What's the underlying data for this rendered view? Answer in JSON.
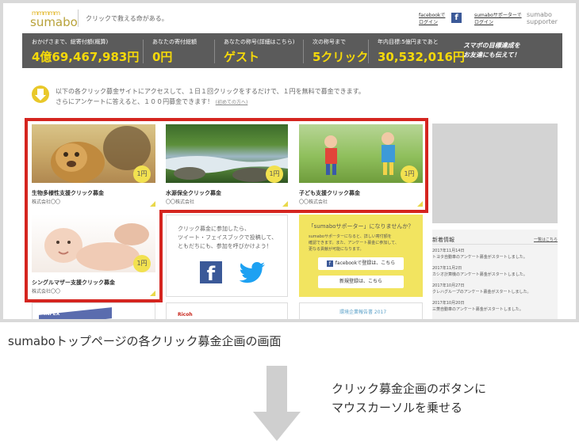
{
  "header": {
    "logo_sun": "ｍｍｍｍｍ",
    "logo_text": "sumabo",
    "tagline": "クリックで救える命がある。",
    "facebook_login": "facebookで ログイン",
    "facebook_icon_letter": "f",
    "supporter_login": "sumaboサポーターで ログイン",
    "supporter_logo_line1": "sumabo",
    "supporter_logo_line2": "supporter"
  },
  "stats": [
    {
      "label": "おかげさまで、総寄付額(概算)",
      "value": "4億69,467,983円"
    },
    {
      "label": "あなたの寄付総額",
      "value": "0円"
    },
    {
      "label": "あなたの称号(詳細はこちら)",
      "value": "ゲスト"
    },
    {
      "label": "次の称号まで",
      "value": "5クリック"
    },
    {
      "label": "年内目標:5億円まであと",
      "value": "30,532,016円"
    }
  ],
  "stats_cta": [
    "スマボの目標達成を",
    "お友達にも伝えて！"
  ],
  "intro": {
    "line1": "以下の各クリック募金サイトにアクセスして、１日１回クリックをするだけで、１円を無料で募金できます。",
    "line2": "さらにアンケートに答えると、１００円募金できます！",
    "link": "(初めての方へ)"
  },
  "cards": [
    {
      "title": "生物多様性支援クリック募金",
      "company": "株式会社〇〇",
      "badge": "1円"
    },
    {
      "title": "水源保全クリック募金",
      "company": "〇〇株式会社",
      "badge": "1円"
    },
    {
      "title": "子ども支援クリック募金",
      "company": "〇〇株式会社",
      "badge": "1円"
    },
    {
      "title": "シングルマザー支援クリック募金",
      "company": "株式会社〇〇",
      "badge": "1円"
    }
  ],
  "social": {
    "line1": "クリック募金に参加したら、",
    "line2": "ツイート・フェイスブックで投稿して、",
    "line3": "ともだちにも、参加を呼びかけよう！",
    "fb_letter": "f"
  },
  "supporter": {
    "title": "「sumaboサポーター」になりませんか？",
    "body1": "sumaboサポーターになると、詳しい寄付額を",
    "body2": "確認できます。また、アンケート募金に参加して、",
    "body3": "更なる貢献が可能になります。",
    "fb_button": "facebookで登録は、こちら",
    "fb_button_icon": "f",
    "register_button": "新規登録は、こちら"
  },
  "news": {
    "title": "新着情報",
    "more": "一覧はこちら",
    "items": [
      {
        "date": "2017年11月14日",
        "text": "トヨタ自動車のアンケート募金がスタートしました。"
      },
      {
        "date": "2017年11月2日",
        "text": "カシオ計算機のアンケート募金がスタートしました。"
      },
      {
        "date": "2017年10月27日",
        "text": "クレハグループのアンケート募金がスタートしました。"
      },
      {
        "date": "2017年10月20日",
        "text": "三菱自動車のアンケート募金がスタートしました。"
      }
    ]
  },
  "bottom_cards": [
    "INPEX",
    "Ricoh",
    "環境企業報告書 2017"
  ],
  "caption": "sumaboトップページの各クリック募金企画の画面",
  "instruction": {
    "line1": "クリック募金企画のボタンに",
    "line2": "マウスカーソルを乗せる"
  },
  "colors": {
    "highlight": "#d5251f",
    "stats_bg": "#5b5b5b",
    "stats_value": "#f5d90a",
    "supporter_bg": "#f2e460",
    "facebook": "#3b5998",
    "twitter": "#1da1f2"
  }
}
